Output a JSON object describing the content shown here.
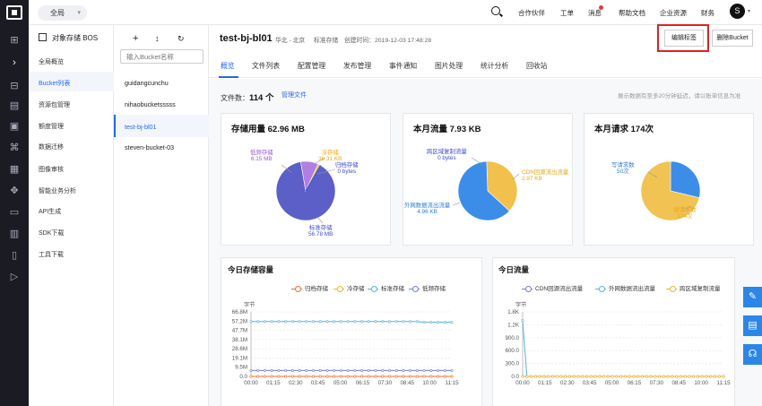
{
  "topbar": {
    "scope_label": "全局",
    "nav": [
      "合作伙伴",
      "工单",
      "消息",
      "帮助文档",
      "企业资源",
      "财务"
    ],
    "avatar_letter": "S"
  },
  "leftnav": {
    "title": "对象存储 BOS",
    "items": [
      "全局概览",
      "Bucket列表",
      "资源包管理",
      "额度管理",
      "数据迁移",
      "图像审核",
      "智能业务分析",
      "API生成",
      "SDK下载",
      "工具下载"
    ]
  },
  "buckets": {
    "search_placeholder": "输入Bucket名称",
    "items": [
      "guidangcunchu",
      "nihaobucketsssss",
      "test-bj-bl01",
      "steven-bucket-03"
    ],
    "selected": "test-bj-bl01"
  },
  "header": {
    "title": "test-bj-bl01",
    "region": "华北 - 北京",
    "storage_class": "标准存储",
    "created": "创建时间：2019-12-03 17:48:28",
    "edit_button": "编辑标签",
    "delete_button": "删除Bucket"
  },
  "tabs": [
    "概览",
    "文件列表",
    "配置管理",
    "发布管理",
    "事件通知",
    "图片处理",
    "统计分析",
    "回收站"
  ],
  "summary": {
    "file_count_label": "文件数：",
    "file_count": "114 个",
    "manage_link": "管理文件",
    "hint": "展示数据有至多20分钟延迟，请以账单信息为准"
  },
  "cards": {
    "storage": {
      "title": "存储用量 62.96 MB",
      "slices": [
        {
          "name": "标准存储",
          "value": "56.78 MB",
          "num": 56.78,
          "color": "#5b5fc7"
        },
        {
          "name": "低频存储",
          "value": "6.15 MB",
          "num": 6.15,
          "color": "#b07fe0"
        },
        {
          "name": "冷存储",
          "value": "36.31 KB",
          "num": 0.04,
          "color": "#f1c24a"
        },
        {
          "name": "归档存储",
          "value": "0 bytes",
          "num": 0,
          "color": "#3a4bd1"
        }
      ]
    },
    "traffic": {
      "title": "本月流量 7.93 KB",
      "slices": [
        {
          "name": "外网数据流出流量",
          "value": "4.96 KB",
          "num": 4.96,
          "color": "#3b8de8"
        },
        {
          "name": "CDN回源流出流量",
          "value": "2.97 KB",
          "num": 2.97,
          "color": "#f2c04d"
        },
        {
          "name": "跨区域复制流量",
          "value": "0 bytes",
          "num": 0,
          "color": "#5b5fc7"
        }
      ]
    },
    "requests": {
      "title": "本月请求 174次",
      "slices": [
        {
          "name": "读请求数",
          "value": "124次",
          "num": 124,
          "color": "#f0c352"
        },
        {
          "name": "写请求数",
          "value": "50次",
          "num": 50,
          "color": "#3b8de8"
        }
      ]
    }
  },
  "lower": {
    "storage_title": "今日存储容量",
    "storage_legend": [
      {
        "name": "归档存储",
        "color": "#e8703a"
      },
      {
        "name": "冷存储",
        "color": "#f0b429"
      },
      {
        "name": "标准存储",
        "color": "#5ab0e0"
      },
      {
        "name": "低频存储",
        "color": "#6f7cd9"
      }
    ],
    "traffic_title": "今日流量",
    "traffic_legend": [
      {
        "name": "CDN回源流出流量",
        "color": "#6f7cd9"
      },
      {
        "name": "外网数据流出流量",
        "color": "#5ab0e0"
      },
      {
        "name": "跨区域复制流量",
        "color": "#f0b429"
      }
    ]
  },
  "chart_data": [
    {
      "type": "line",
      "title": "今日存储容量",
      "ylabel": "字节",
      "yticks": [
        "66.8M",
        "57.2M",
        "47.7M",
        "38.1M",
        "28.6M",
        "19.1M",
        "9.5M",
        "0.0"
      ],
      "x": [
        "00:00",
        "01:15",
        "02:30",
        "03:45",
        "05:00",
        "06:15",
        "07:30",
        "08:45",
        "10:00",
        "11:15"
      ],
      "ylim": [
        0,
        66.8
      ],
      "series": [
        {
          "name": "标准存储",
          "values": [
            56.8,
            56.8,
            56.8,
            56.8,
            56.8,
            56.8,
            56.8,
            56.8,
            56.8,
            56.8,
            56.8,
            56.8,
            56.8,
            56.8,
            56.8,
            56.8,
            56.8,
            56.8,
            56.8,
            56.8,
            56.8,
            56.8,
            56.8,
            56.8,
            56.8,
            56.0,
            56.0,
            56.0,
            56.0,
            56.0
          ]
        },
        {
          "name": "低频存储",
          "values": [
            6.15,
            6.15,
            6.15,
            6.15,
            6.15,
            6.15,
            6.15,
            6.15,
            6.15,
            6.15,
            6.15,
            6.15,
            6.15,
            6.15,
            6.15,
            6.15,
            6.15,
            6.15,
            6.15,
            6.15,
            6.15,
            6.15,
            6.15,
            6.15,
            6.15,
            6.15,
            6.15,
            6.15,
            6.15,
            6.15
          ]
        },
        {
          "name": "冷存储",
          "values": [
            0.04,
            0.04,
            0.04,
            0.04,
            0.04,
            0.04,
            0.04,
            0.04,
            0.04,
            0.04,
            0.04,
            0.04,
            0.04,
            0.04,
            0.04,
            0.04,
            0.04,
            0.04,
            0.04,
            0.04,
            0.04,
            0.04,
            0.04,
            0.04,
            0.04,
            0.04,
            0.04,
            0.04,
            0.04,
            0.04
          ]
        },
        {
          "name": "归档存储",
          "values": [
            0,
            0,
            0,
            0,
            0,
            0,
            0,
            0,
            0,
            0,
            0,
            0,
            0,
            0,
            0,
            0,
            0,
            0,
            0,
            0,
            0,
            0,
            0,
            0,
            0,
            0,
            0,
            0,
            0,
            0
          ]
        }
      ]
    },
    {
      "type": "line",
      "title": "今日流量",
      "ylabel": "字节",
      "yticks": [
        "1.8K",
        "1.2K",
        "900.0",
        "600.0",
        "300.0",
        "0.0"
      ],
      "x": [
        "00:00",
        "01:15",
        "02:30",
        "03:45",
        "05:00",
        "06:15",
        "07:30",
        "08:45",
        "10:00",
        "11:15"
      ],
      "ylim": [
        0,
        1500
      ],
      "series": [
        {
          "name": "外网数据流出流量",
          "values": [
            1300,
            0,
            0,
            0,
            0,
            0,
            0,
            0,
            0,
            0,
            0,
            0,
            0,
            0,
            0,
            0,
            0,
            0,
            0,
            0,
            0,
            0,
            0,
            0,
            0,
            0,
            0,
            0,
            0,
            0,
            0,
            0,
            0,
            0,
            0,
            0,
            0,
            0,
            0,
            0,
            0,
            0,
            0,
            0,
            0,
            0,
            0,
            0
          ]
        },
        {
          "name": "CDN回源流出流量",
          "values": [
            0,
            0,
            0,
            0,
            0,
            0,
            0,
            0,
            0,
            0,
            0,
            0,
            0,
            0,
            0,
            0,
            0,
            0,
            0,
            0,
            0,
            0,
            0,
            0,
            0,
            0,
            0,
            0,
            0,
            0,
            0,
            0,
            0,
            0,
            0,
            0,
            0,
            0,
            0,
            0,
            0,
            0,
            0,
            0,
            0,
            0,
            0,
            0
          ]
        },
        {
          "name": "跨区域复制流量",
          "values": [
            0,
            0,
            0,
            0,
            0,
            0,
            0,
            0,
            0,
            0,
            0,
            0,
            0,
            0,
            0,
            0,
            0,
            0,
            0,
            0,
            0,
            0,
            0,
            0,
            0,
            0,
            0,
            0,
            0,
            0,
            0,
            0,
            0,
            0,
            0,
            0,
            0,
            0,
            0,
            0,
            0,
            0,
            0,
            0,
            0,
            0,
            0,
            0
          ]
        }
      ]
    }
  ]
}
